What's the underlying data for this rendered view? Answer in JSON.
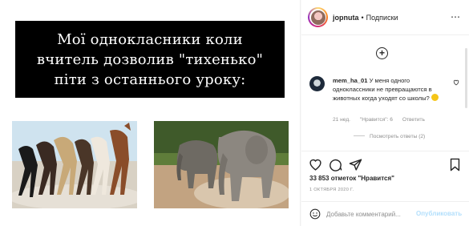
{
  "post": {
    "caption_text": "Мої однокласники коли\nвчитель дозволив \"тихенько\"\nпіти з останнього уроку:",
    "photo_left": "horses",
    "photo_right": "elephants"
  },
  "header": {
    "username": "jopnuta",
    "separator": "•",
    "follow_label": "Подписки",
    "more_icon": "⋯"
  },
  "comment": {
    "username": "mem_ha_01",
    "text": "У меня одного одноклассники не превращаются в животных когда уходят со школы?",
    "emoji": "thinking-face-emoji",
    "time": "21 нед.",
    "likes": "\"Нравится\": 6",
    "reply_label": "Ответить",
    "view_replies": "Посмотреть ответы (2)"
  },
  "actions": {
    "likes_count": "33 853 отметок \"Нравится\"",
    "date": "1 ОКТЯБРЯ 2020 Г."
  },
  "add_comment": {
    "placeholder": "Добавьте комментарий...",
    "publish_label": "Опубликовать"
  },
  "colors": {
    "text": "#262626",
    "muted": "#8e8e8e",
    "publish_disabled": "#b2dffc",
    "border": "#efefef"
  }
}
